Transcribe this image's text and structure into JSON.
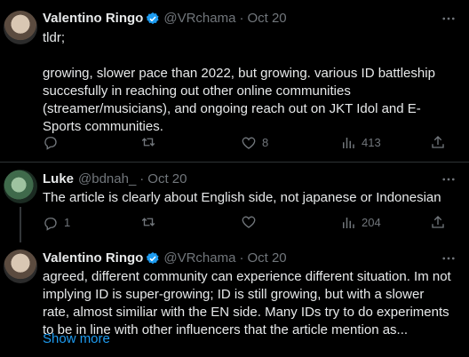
{
  "tweets": [
    {
      "name": "Valentino Ringo",
      "handle": "@VRchama",
      "separator": "·",
      "date": "Oct 20",
      "text": "tldr;\n\ngrowing, slower pace than 2022, but growing. various ID battleship succesfully in reaching out other online communities (streamer/musicians), and ongoing reach out on JKT Idol and E-Sports communities.",
      "replies": "",
      "retweets": "",
      "likes": "8",
      "views": "413"
    },
    {
      "name": "Luke",
      "handle": "@bdnah_",
      "separator": "·",
      "date": "Oct 20",
      "text": "The article is clearly about English side, not japanese or Indonesian",
      "replies": "1",
      "retweets": "",
      "likes": "",
      "views": "204"
    },
    {
      "name": "Valentino Ringo",
      "handle": "@VRchama",
      "separator": "·",
      "date": "Oct 20",
      "text": "agreed, different community can experience different situation. Im not implying ID is super-growing; ID is still growing, but with a slower rate, almost similiar with the EN side. Many IDs try to do experiments to be in line with other influencers that the article mention as...",
      "show_more": "Show more"
    }
  ],
  "icons": {
    "reply": "reply-icon",
    "retweet": "retweet-icon",
    "like": "heart-icon",
    "views": "views-icon",
    "share": "share-icon",
    "more": "more-icon",
    "verified": "verified-badge-icon"
  },
  "colors": {
    "background": "#000000",
    "text": "#e7e9ea",
    "muted": "#71767b",
    "accent": "#1d9bf0",
    "divider": "#2f3336"
  }
}
